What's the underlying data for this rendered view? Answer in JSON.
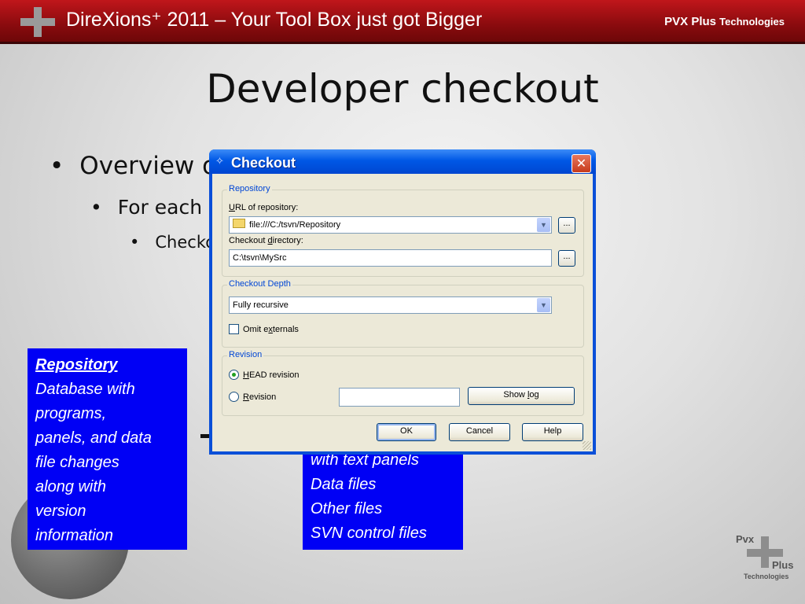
{
  "header": {
    "title": "DireXions⁺ 2011 – Your Tool Box just got Bigger",
    "company_main": "PVX Plus",
    "company_small": "Technologies"
  },
  "slide": {
    "title": "Developer checkout",
    "bullets": [
      {
        "text": "Overview o"
      },
      {
        "text": "For each"
      },
      {
        "text": "Checko"
      }
    ]
  },
  "callouts": {
    "left": {
      "heading": "Repository",
      "lines": [
        "Database with",
        "programs,",
        "panels, and data",
        "file changes",
        "along with",
        "version",
        "information"
      ]
    },
    "right": {
      "lines": [
        "with text panels",
        "Data files",
        "Other files",
        "SVN control files"
      ]
    }
  },
  "dialog": {
    "title": "Checkout",
    "close_glyph": "✕",
    "repository_group": "Repository",
    "url_label_prefix": "",
    "url_label_u": "U",
    "url_label_rest": "RL of repository:",
    "url_value": "file:///C:/tsvn/Repository",
    "dir_label_a": "Checkout ",
    "dir_label_u": "d",
    "dir_label_b": "irectory:",
    "dir_value": "C:\\tsvn\\MySrc",
    "browse_label": "...",
    "depth_group": "Checkout Depth",
    "depth_value": "Fully recursive",
    "omit_a": "Omit e",
    "omit_u": "x",
    "omit_b": "ternals",
    "omit_checked": false,
    "revision_group": "Revision",
    "head_u": "H",
    "head_rest": "EAD revision",
    "rev_u": "R",
    "rev_rest": "evision",
    "revision_value": "",
    "show_log_a": "Show ",
    "show_log_u": "l",
    "show_log_b": "og",
    "ok": "OK",
    "cancel": "Cancel",
    "help": "Help",
    "selected_revision": "head"
  },
  "corner_logo": {
    "pvx": "Pvx",
    "plus": "Plus",
    "tech": "Technologies"
  },
  "colors": {
    "header_red": "#a4101a",
    "callout_blue": "#0000f5",
    "dialog_blue": "#0058e6"
  }
}
